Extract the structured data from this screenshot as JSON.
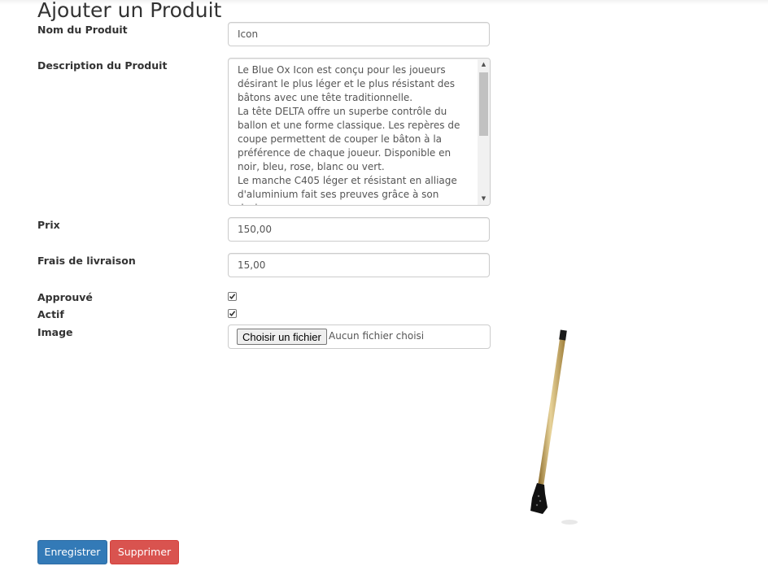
{
  "page": {
    "title": "Ajouter un Produit"
  },
  "form": {
    "name": {
      "label": "Nom du Produit",
      "value": "Icon"
    },
    "description": {
      "label": "Description du Produit",
      "value": "Le Blue Ox Icon est conçu pour les joueurs désirant le plus léger et le plus résistant des bâtons avec une tête traditionnelle.\nLa tête DELTA offre un superbe contrôle du ballon et une forme classique. Les repères de coupe permettent de couper le bâton à la préférence de chaque joueur. Disponible en noir, bleu, rose, blanc ou vert.\nLe manche C405 léger et résistant en alliage d'aluminium fait ses preuves grâce à son design"
    },
    "price": {
      "label": "Prix",
      "value": "150,00"
    },
    "shipping": {
      "label": "Frais de livraison",
      "value": "15,00"
    },
    "approved": {
      "label": "Approuvé",
      "checked": true
    },
    "active": {
      "label": "Actif",
      "checked": true
    },
    "image": {
      "label": "Image",
      "button_label": "Choisir un fichier",
      "status": "Aucun fichier choisi"
    }
  },
  "actions": {
    "save_label": "Enregistrer",
    "delete_label": "Supprimer"
  },
  "colors": {
    "primary": "#337ab7",
    "danger": "#d9534f"
  },
  "icons": {
    "scroll_up": "triangle-up-icon",
    "scroll_down": "triangle-down-icon",
    "checkmark": "checkmark-icon"
  }
}
